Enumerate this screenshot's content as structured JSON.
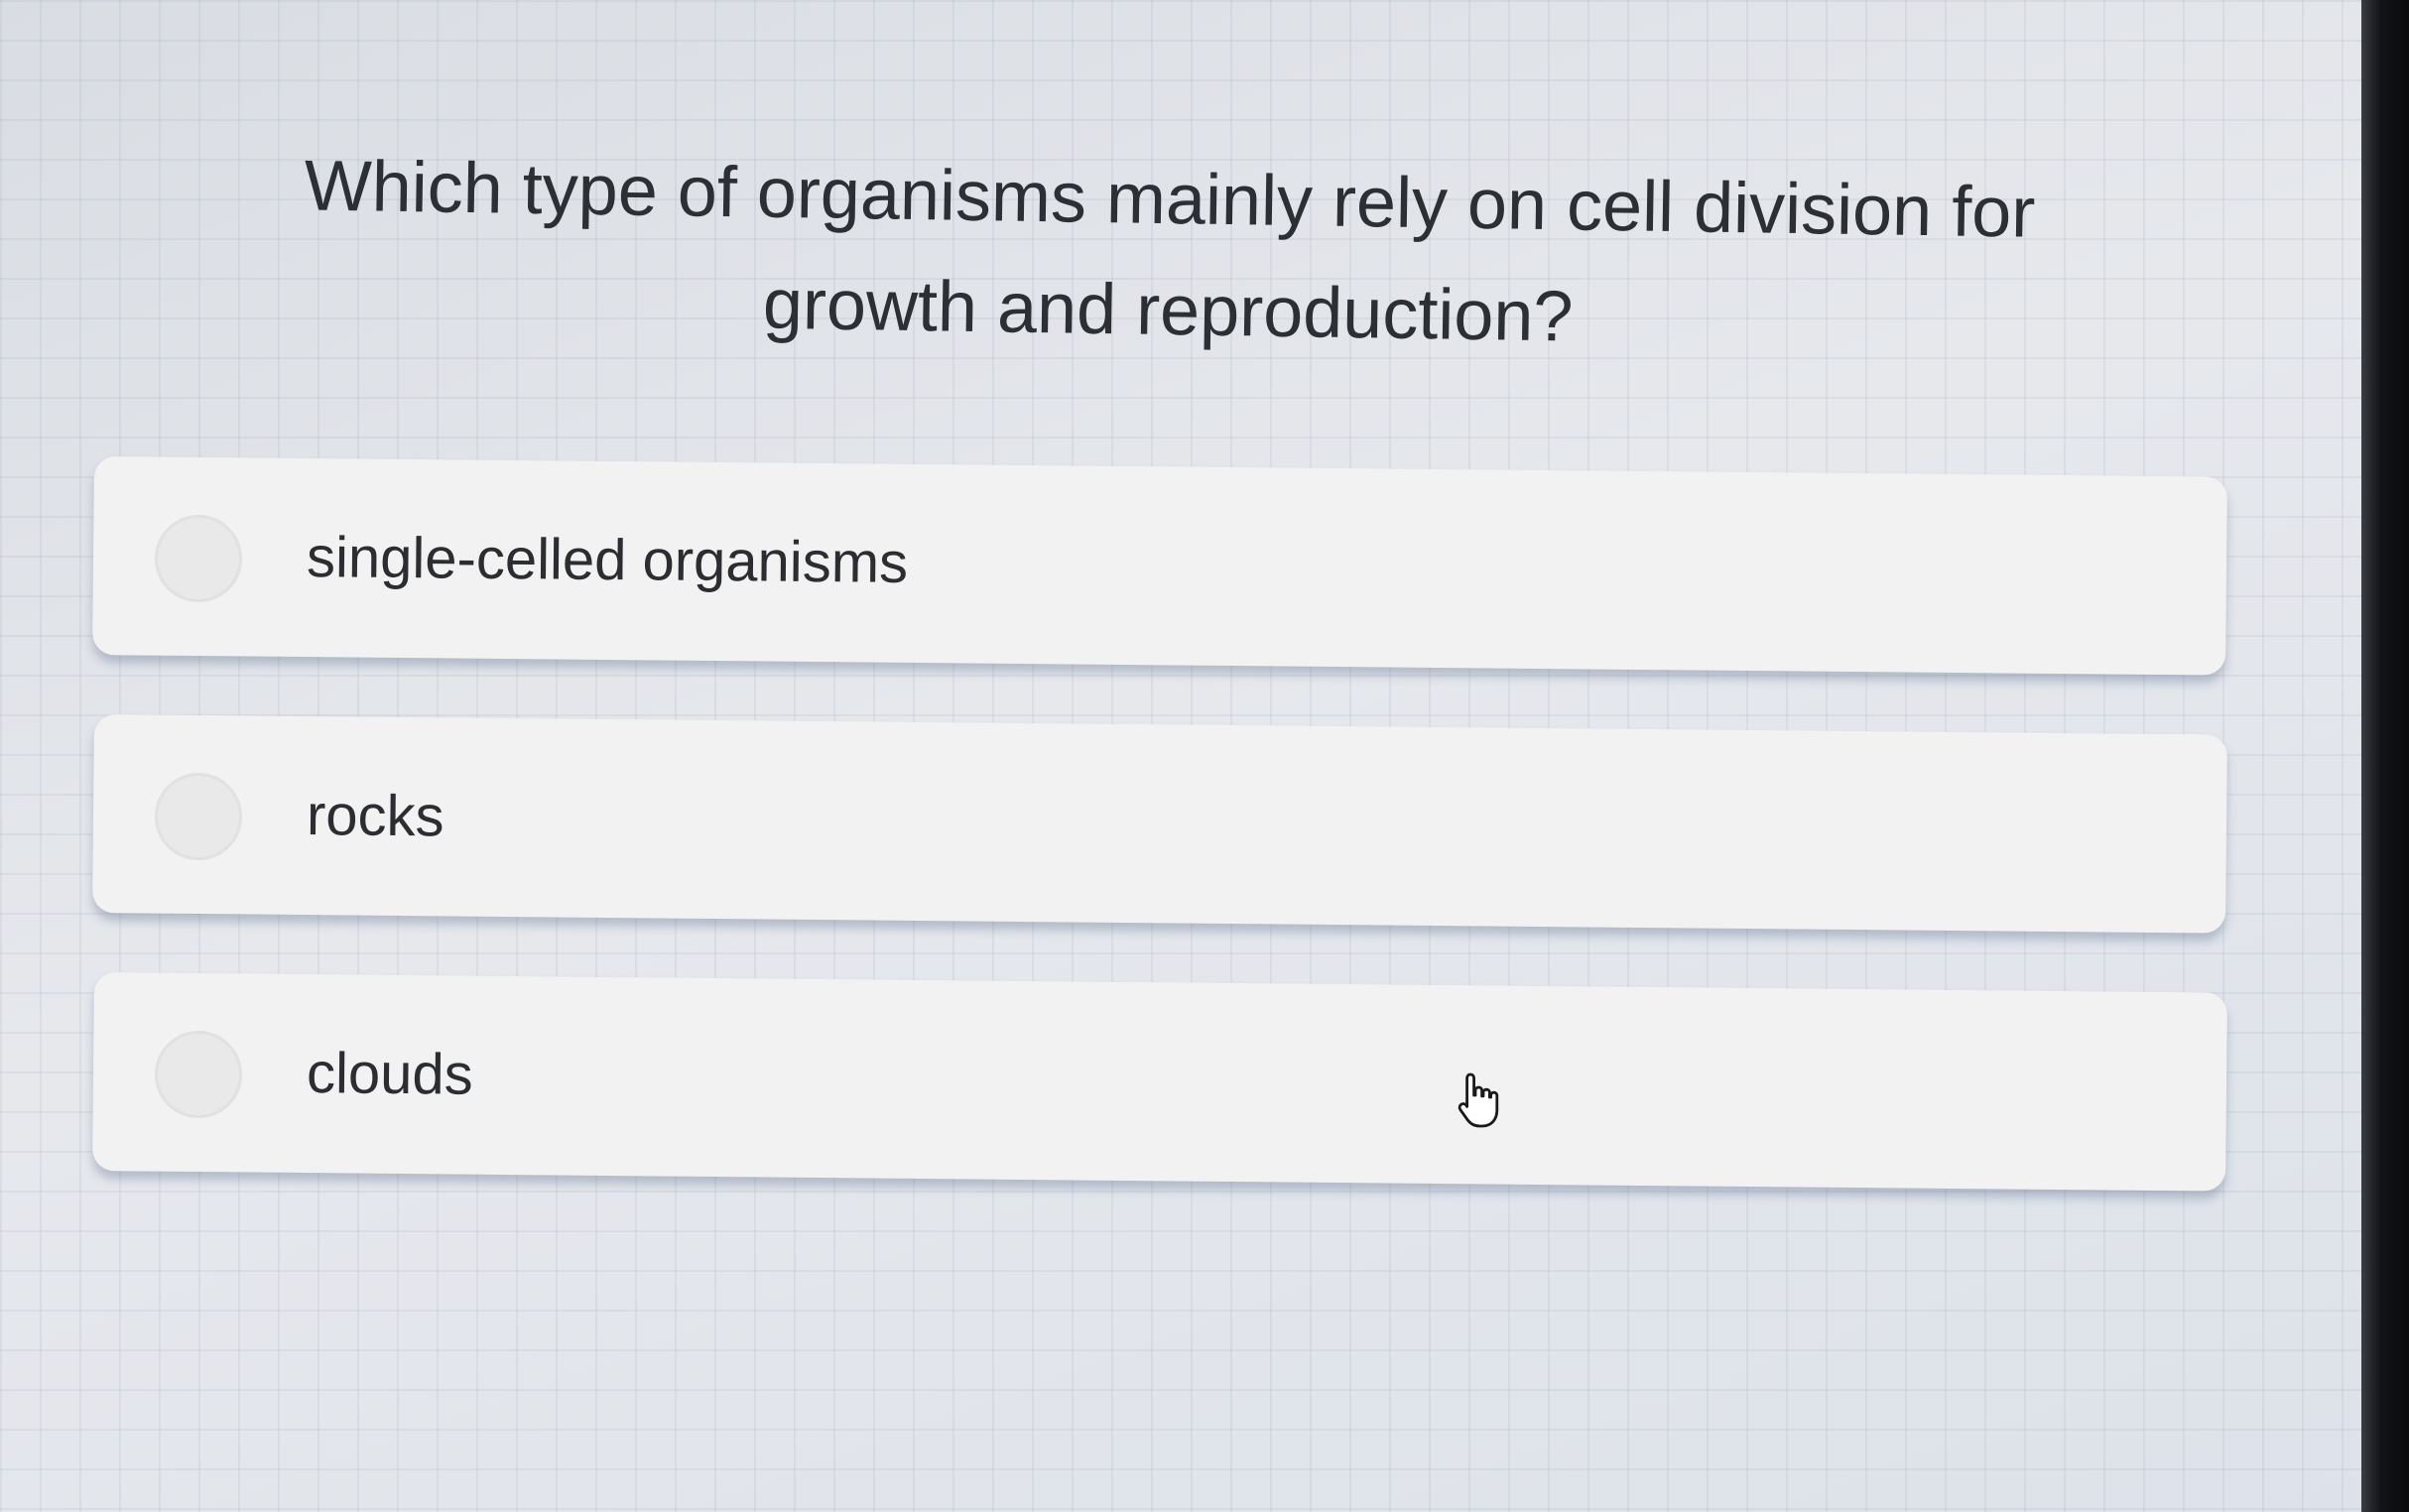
{
  "quiz": {
    "question": "Which type of organisms mainly rely on cell division for growth and reproduction?",
    "options": [
      {
        "label": "single-celled organisms"
      },
      {
        "label": "rocks"
      },
      {
        "label": "clouds"
      }
    ]
  },
  "cursor": {
    "icon": "hand-pointer-icon"
  },
  "colors": {
    "background": "#e4e7ec",
    "option_card": "#f2f2f2",
    "text": "#2c2f33"
  }
}
